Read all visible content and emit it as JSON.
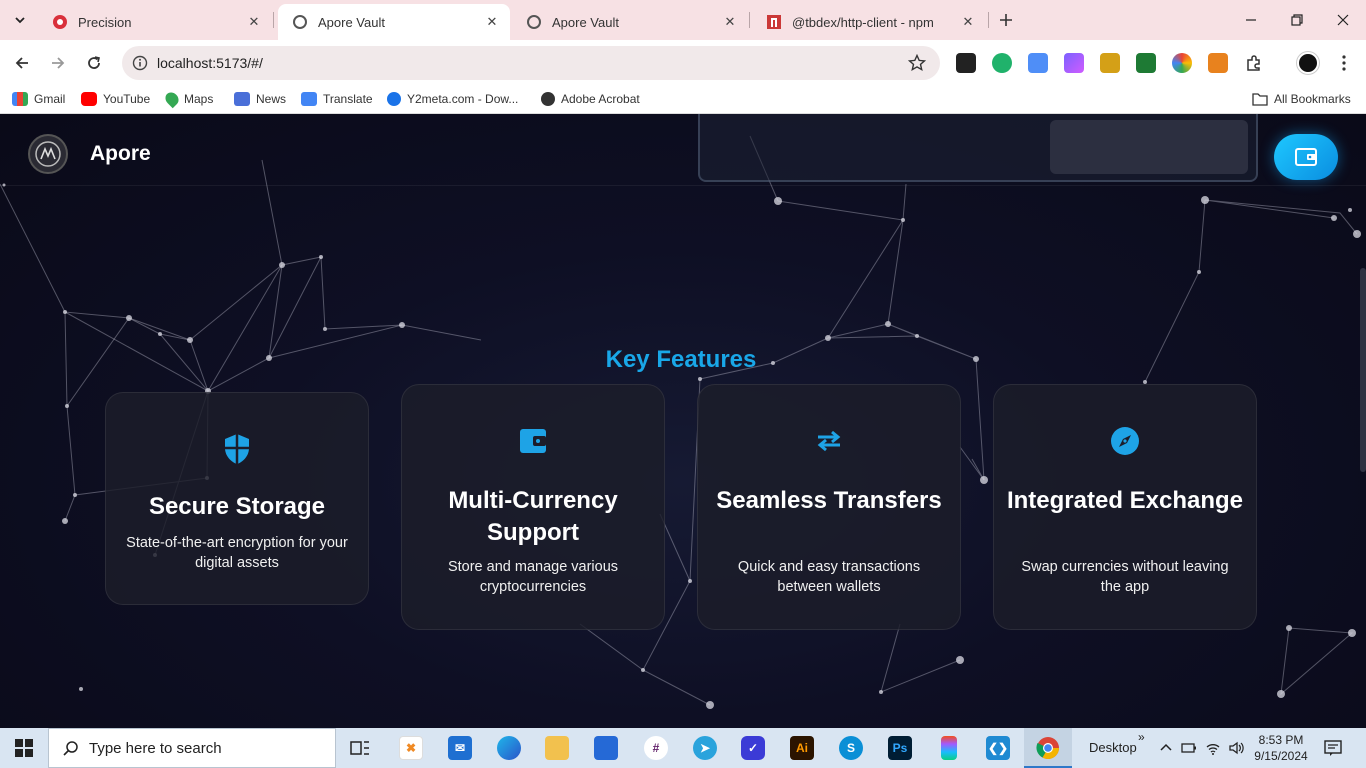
{
  "browser": {
    "tabs": [
      {
        "title": "Precision",
        "icon": "precision-favicon"
      },
      {
        "title": "Apore Vault",
        "icon": "apore-favicon",
        "active": true
      },
      {
        "title": "Apore Vault",
        "icon": "apore-favicon"
      },
      {
        "title": "@tbdex/http-client - npm",
        "icon": "npm-favicon"
      }
    ],
    "url": "localhost:5173/#/",
    "bookmarks": [
      {
        "label": "Gmail",
        "color": "#ea4335"
      },
      {
        "label": "YouTube",
        "color": "#ff0000"
      },
      {
        "label": "Maps",
        "color": "#34a853"
      },
      {
        "label": "News",
        "color": "#4a6fd8"
      },
      {
        "label": "Translate",
        "color": "#4285f4"
      },
      {
        "label": "Y2meta.com - Dow...",
        "color": "#1a73e8"
      },
      {
        "label": "Adobe Acrobat",
        "color": "#333333"
      }
    ],
    "all_bookmarks": "All Bookmarks"
  },
  "page": {
    "brand": "Apore",
    "section_title": "Key Features",
    "accent": "#19a7e8",
    "features": [
      {
        "icon": "shield-icon",
        "title": "Secure Storage",
        "desc": "State-of-the-art encryption for your digital assets"
      },
      {
        "icon": "wallet-icon",
        "title": "Multi-Currency Support",
        "desc": "Store and manage various cryptocurrencies"
      },
      {
        "icon": "transfer-arrows-icon",
        "title": "Seamless Transfers",
        "desc": "Quick and easy transactions between wallets"
      },
      {
        "icon": "compass-icon",
        "title": "Integrated Exchange",
        "desc": "Swap currencies without leaving the app"
      }
    ]
  },
  "taskbar": {
    "search_placeholder": "Type here to search",
    "desktop_label": "Desktop",
    "time": "8:53 PM",
    "date": "9/15/2024"
  }
}
